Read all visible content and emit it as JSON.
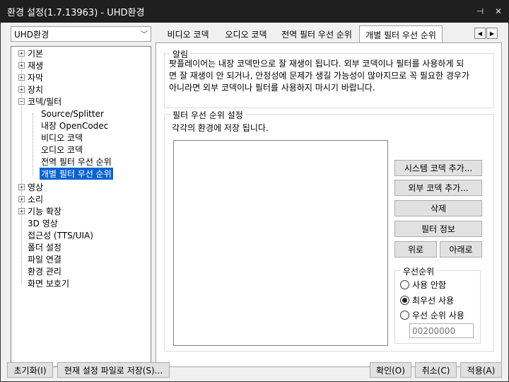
{
  "window": {
    "title": "환경 설정(1.7.13963) - UHD환경",
    "pin_icon": "pin-icon",
    "close_icon": "close-icon"
  },
  "profile": {
    "selected": "UHD환경"
  },
  "tree": {
    "items": [
      {
        "label": "기본",
        "expander": "+"
      },
      {
        "label": "재생",
        "expander": "+"
      },
      {
        "label": "자막",
        "expander": "+"
      },
      {
        "label": "장치",
        "expander": "+"
      },
      {
        "label": "코덱/필터",
        "expander": "−"
      },
      {
        "label": "Source/Splitter"
      },
      {
        "label": "내장 OpenCodec"
      },
      {
        "label": "비디오 코덱"
      },
      {
        "label": "오디오 코덱"
      },
      {
        "label": "전역 필터 우선 순위"
      },
      {
        "label": "개별 필터 우선 순위"
      },
      {
        "label": "영상",
        "expander": "+"
      },
      {
        "label": "소리",
        "expander": "+"
      },
      {
        "label": "기능 확장",
        "expander": "+"
      },
      {
        "label": "3D 영상"
      },
      {
        "label": "접근성 (TTS/UIA)"
      },
      {
        "label": "폴더 설정"
      },
      {
        "label": "파일 연결"
      },
      {
        "label": "환경 관리"
      },
      {
        "label": "화면 보호기"
      }
    ]
  },
  "tabs": [
    {
      "label": "비디오 코덱"
    },
    {
      "label": "오디오 코덱"
    },
    {
      "label": "전역 필터 우선 순위"
    },
    {
      "label": "개별 필터 우선 순위"
    }
  ],
  "notice": {
    "title": "알림",
    "lines": [
      "팟플레이어는 내장 코덱만으로 잘 재생이 됩니다. 외부 코덱이나 필터를 사용하게 되",
      "면 잘 재생이 안 되거나, 안정성에 문제가 생길 가능성이 많아지므로 꼭 필요한 경우가",
      "아니라면 외부 코덱이나 필터를 사용하지 마시기 바랍니다."
    ]
  },
  "filter_priority": {
    "title": "필터 우선 순위 설정",
    "subtitle": "각각의 환경에 저장 됩니다.",
    "buttons": {
      "add_system": "시스템 코덱 추가...",
      "add_external": "외부 코덱 추가...",
      "delete": "삭제",
      "filter_info": "필터 정보",
      "up": "위로",
      "down": "아래로"
    },
    "priority_group": {
      "title": "우선순위",
      "options": [
        "사용 안함",
        "최우선 사용",
        "우선 순위 사용"
      ],
      "selected_index": 1,
      "value": "00200000"
    }
  },
  "footer": {
    "reset": "초기화(I)",
    "save_current": "현재 설정 파일로 저장(S)...",
    "ok": "확인(O)",
    "cancel": "취소(C)",
    "apply": "적용(A)"
  }
}
